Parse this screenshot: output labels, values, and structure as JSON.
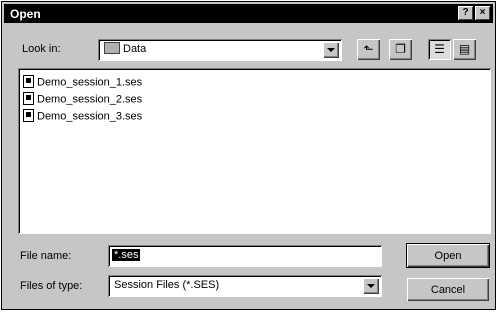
{
  "dialog": {
    "title": "Open",
    "help_glyph": "?",
    "close_glyph": "×"
  },
  "look_in": {
    "label": "Look in:",
    "value": "Data"
  },
  "toolbar": {
    "up_icon": "up-folder-icon",
    "new_folder_icon": "new-folder-icon",
    "list_view_icon": "list-view-icon",
    "details_view_icon": "details-view-icon"
  },
  "files": [
    {
      "name": "Demo_session_1.ses"
    },
    {
      "name": "Demo_session_2.ses"
    },
    {
      "name": "Demo_session_3.ses"
    }
  ],
  "file_name": {
    "label": "File name:",
    "value": "*.ses"
  },
  "file_type": {
    "label": "Files of type:",
    "value": "Session Files (*.SES)"
  },
  "buttons": {
    "open": "Open",
    "cancel": "Cancel"
  }
}
